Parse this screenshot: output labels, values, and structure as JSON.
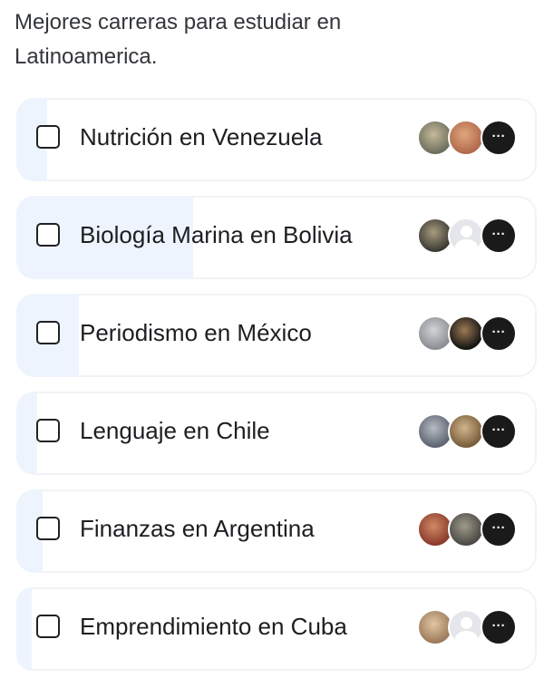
{
  "poll": {
    "question": "Mejores carreras para estudiar en Latinoamerica.",
    "more_label": "···",
    "options": [
      {
        "label": "Nutrición en Venezuela",
        "fill": 0.06,
        "avatars": [
          {
            "kind": "photo",
            "colors": [
              "#6b6f5e",
              "#c7b99a"
            ]
          },
          {
            "kind": "photo",
            "colors": [
              "#b06a4c",
              "#e0a57d"
            ]
          }
        ]
      },
      {
        "label": "Biología Marina en Bolivia",
        "fill": 0.34,
        "avatars": [
          {
            "kind": "photo",
            "colors": [
              "#3c3a33",
              "#a89c80"
            ]
          },
          {
            "kind": "placeholder",
            "colors": [
              "#e4e6eb",
              "#ffffff"
            ]
          }
        ]
      },
      {
        "label": "Periodismo en México",
        "fill": 0.12,
        "avatars": [
          {
            "kind": "photo",
            "colors": [
              "#8a8d92",
              "#d2d4d6"
            ]
          },
          {
            "kind": "photo",
            "colors": [
              "#141414",
              "#9c7a52"
            ]
          }
        ]
      },
      {
        "label": "Lenguaje en Chile",
        "fill": 0.04,
        "avatars": [
          {
            "kind": "photo",
            "colors": [
              "#5d6470",
              "#b7bcc4"
            ]
          },
          {
            "kind": "photo",
            "colors": [
              "#7a5e3c",
              "#d0b58c"
            ]
          }
        ]
      },
      {
        "label": "Finanzas en Argentina",
        "fill": 0.05,
        "avatars": [
          {
            "kind": "photo",
            "colors": [
              "#8a3b2a",
              "#d08a66"
            ]
          },
          {
            "kind": "photo",
            "colors": [
              "#4a4a45",
              "#9f9a8a"
            ]
          }
        ]
      },
      {
        "label": "Emprendimiento en Cuba",
        "fill": 0.03,
        "avatars": [
          {
            "kind": "photo",
            "colors": [
              "#9a7a5a",
              "#e2c6a2"
            ]
          },
          {
            "kind": "placeholder",
            "colors": [
              "#e4e6eb",
              "#ffffff"
            ]
          }
        ]
      }
    ]
  }
}
